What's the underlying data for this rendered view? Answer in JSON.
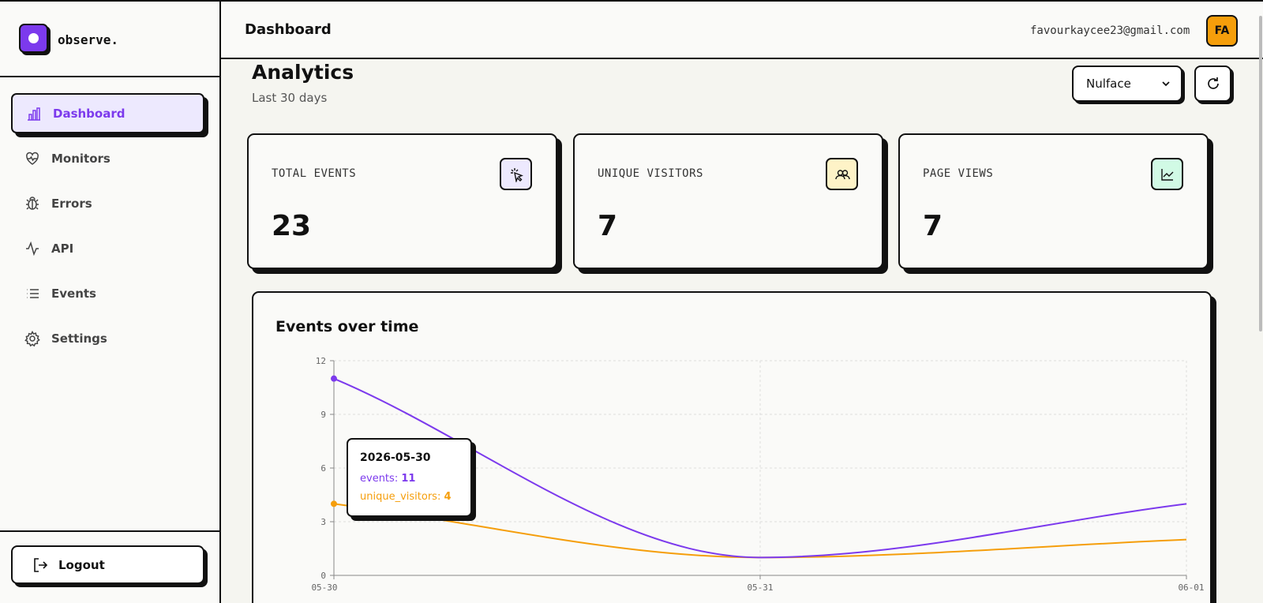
{
  "app": {
    "name": "observe."
  },
  "sidebar": {
    "items": [
      {
        "label": "Dashboard",
        "icon": "bar-chart-icon",
        "active": true
      },
      {
        "label": "Monitors",
        "icon": "heartbeat-icon",
        "active": false
      },
      {
        "label": "Errors",
        "icon": "bug-icon",
        "active": false
      },
      {
        "label": "API",
        "icon": "activity-icon",
        "active": false
      },
      {
        "label": "Events",
        "icon": "list-icon",
        "active": false
      },
      {
        "label": "Settings",
        "icon": "gear-icon",
        "active": false
      }
    ],
    "logout_label": "Logout"
  },
  "header": {
    "title": "Dashboard",
    "user_email": "favourkaycee23@gmail.com",
    "avatar_initials": "FA"
  },
  "page": {
    "title": "Analytics",
    "subtitle": "Last 30 days",
    "project_select": {
      "value": "Nulface"
    }
  },
  "stats": [
    {
      "label": "TOTAL EVENTS",
      "value": "23",
      "icon": "cursor-click-icon",
      "icon_bg": "#ede9fe"
    },
    {
      "label": "UNIQUE VISITORS",
      "value": "7",
      "icon": "users-icon",
      "icon_bg": "#fef3c7"
    },
    {
      "label": "PAGE VIEWS",
      "value": "7",
      "icon": "line-chart-icon",
      "icon_bg": "#d1fae5"
    }
  ],
  "chart_title": "Events over time",
  "tooltip": {
    "date": "2026-05-30",
    "events_label": "events",
    "events_value": "11",
    "visitors_label": "unique_visitors",
    "visitors_value": "4"
  },
  "colors": {
    "accent": "#7c3aed",
    "events": "#7c3aed",
    "visitors": "#f59e0b"
  },
  "chart_data": {
    "type": "line",
    "x": [
      "05-30",
      "05-31",
      "06-01"
    ],
    "series": [
      {
        "name": "events",
        "values": [
          11,
          1,
          4
        ],
        "color": "#7c3aed"
      },
      {
        "name": "unique_visitors",
        "values": [
          4,
          1,
          2
        ],
        "color": "#f59e0b"
      }
    ],
    "ylim": [
      0,
      12
    ],
    "yticks": [
      "0",
      "3",
      "6",
      "9",
      "12"
    ],
    "grid": true
  }
}
